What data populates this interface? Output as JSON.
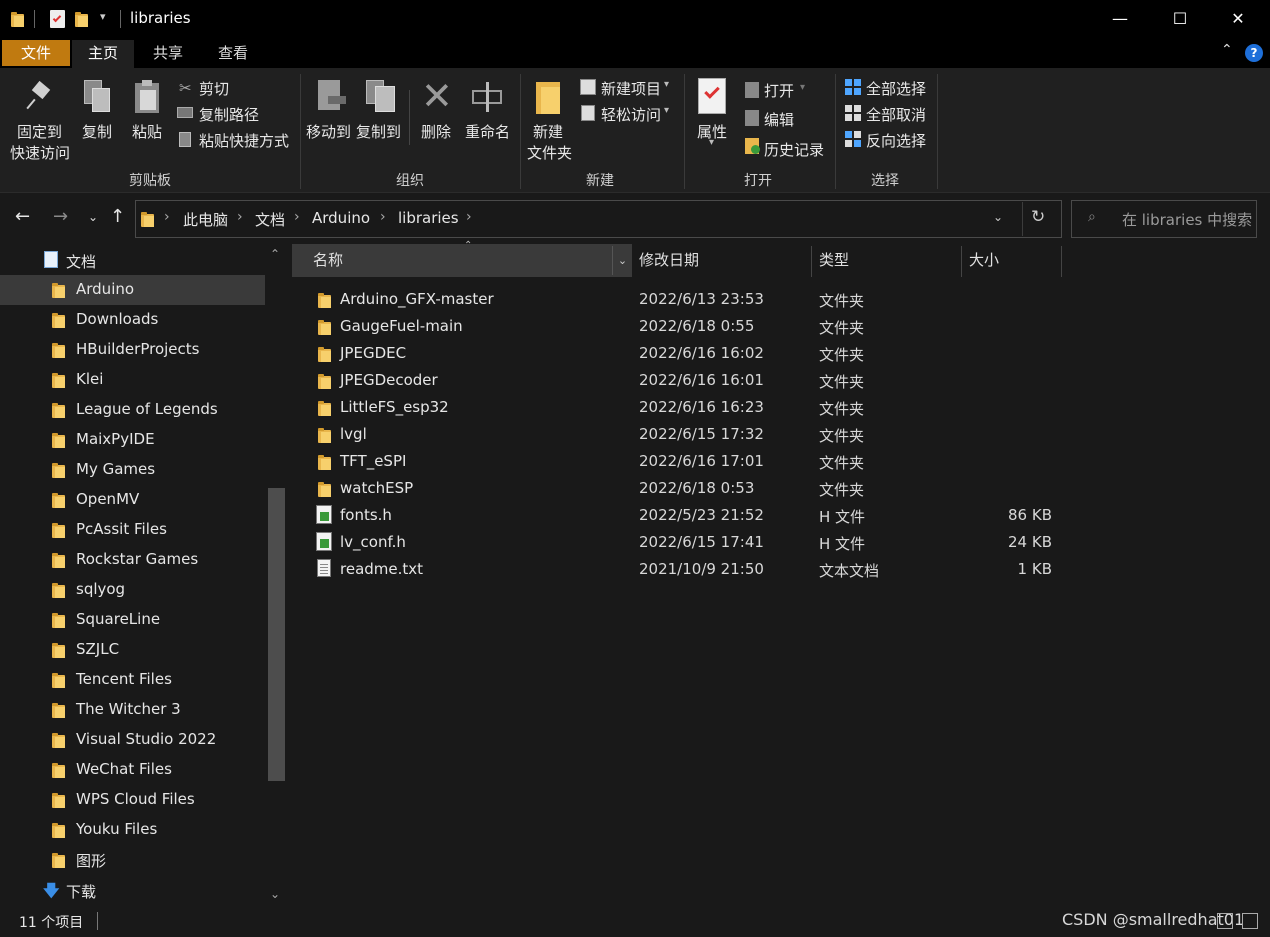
{
  "window": {
    "title": "libraries",
    "minimize": "—",
    "maximize": "☐",
    "close": "✕"
  },
  "ribbon_tabs": [
    "文件",
    "主页",
    "共享",
    "查看"
  ],
  "clipboard": {
    "pin_line1": "固定到",
    "pin_line2": "快速访问",
    "copy": "复制",
    "paste": "粘贴",
    "cut": "剪切",
    "copy_path": "复制路径",
    "paste_shortcut": "粘贴快捷方式",
    "group": "剪贴板"
  },
  "organize": {
    "move_to": "移动到",
    "copy_to": "复制到",
    "delete": "删除",
    "rename": "重命名",
    "group": "组织"
  },
  "new": {
    "new_folder_line1": "新建",
    "new_folder_line2": "文件夹",
    "new_item": "新建项目",
    "easy_access": "轻松访问",
    "group": "新建"
  },
  "open": {
    "properties": "属性",
    "open": "打开",
    "edit": "编辑",
    "history": "历史记录",
    "group": "打开"
  },
  "select": {
    "select_all": "全部选择",
    "select_none": "全部取消",
    "invert": "反向选择",
    "group": "选择"
  },
  "address": {
    "crumbs": [
      "此电脑",
      "文档",
      "Arduino",
      "libraries"
    ]
  },
  "search": {
    "placeholder": "在 libraries 中搜索"
  },
  "nav": {
    "parent": "文档",
    "items": [
      "Arduino",
      "Downloads",
      "HBuilderProjects",
      "Klei",
      "League of Legends",
      "MaixPyIDE",
      "My Games",
      "OpenMV",
      "PcAssit Files",
      "Rockstar Games",
      "sqlyog",
      "SquareLine",
      "SZJLC",
      "Tencent Files",
      "The Witcher 3",
      "Visual Studio 2022",
      "WeChat Files",
      "WPS Cloud Files",
      "Youku Files",
      "图形"
    ],
    "downloads": "下载"
  },
  "columns": {
    "name": "名称",
    "date": "修改日期",
    "type": "类型",
    "size": "大小"
  },
  "files": [
    {
      "name": "Arduino_GFX-master",
      "date": "2022/6/13 23:53",
      "type": "文件夹",
      "size": "",
      "icon": "folder"
    },
    {
      "name": "GaugeFuel-main",
      "date": "2022/6/18 0:55",
      "type": "文件夹",
      "size": "",
      "icon": "folder"
    },
    {
      "name": "JPEGDEC",
      "date": "2022/6/16 16:02",
      "type": "文件夹",
      "size": "",
      "icon": "folder"
    },
    {
      "name": "JPEGDecoder",
      "date": "2022/6/16 16:01",
      "type": "文件夹",
      "size": "",
      "icon": "folder"
    },
    {
      "name": "LittleFS_esp32",
      "date": "2022/6/16 16:23",
      "type": "文件夹",
      "size": "",
      "icon": "folder"
    },
    {
      "name": "lvgl",
      "date": "2022/6/15 17:32",
      "type": "文件夹",
      "size": "",
      "icon": "folder"
    },
    {
      "name": "TFT_eSPI",
      "date": "2022/6/16 17:01",
      "type": "文件夹",
      "size": "",
      "icon": "folder"
    },
    {
      "name": "watchESP",
      "date": "2022/6/18 0:53",
      "type": "文件夹",
      "size": "",
      "icon": "folder"
    },
    {
      "name": "fonts.h",
      "date": "2022/5/23 21:52",
      "type": "H 文件",
      "size": "86 KB",
      "icon": "h-file"
    },
    {
      "name": "lv_conf.h",
      "date": "2022/6/15 17:41",
      "type": "H 文件",
      "size": "24 KB",
      "icon": "h-file"
    },
    {
      "name": "readme.txt",
      "date": "2021/10/9 21:50",
      "type": "文本文档",
      "size": "1 KB",
      "icon": "text-file"
    }
  ],
  "status": {
    "count": "11 个项目"
  },
  "watermark": "CSDN @smallredhat01",
  "colors": {
    "accent_tab": "#c07a10",
    "background": "#191919",
    "ribbon": "#202020",
    "selected": "#3a3a3a"
  }
}
